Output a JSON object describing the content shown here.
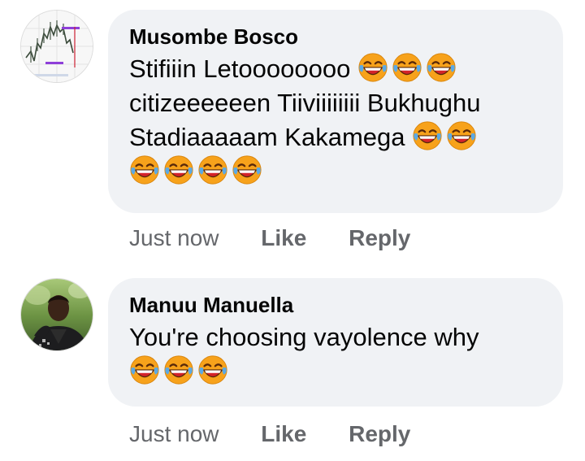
{
  "comments": [
    {
      "author": "Musombe Bosco",
      "lines": [
        {
          "text": "Stifiiin Letoooooooo",
          "emoji_count": 3
        },
        {
          "text": "citizeeeeeen Tiiviiiiiiii Bukhughu",
          "emoji_count": 0
        },
        {
          "text": "Stadiaaaaam Kakamega",
          "emoji_count": 2
        },
        {
          "text": "",
          "emoji_count": 4
        }
      ],
      "avatar_icon": "stock-chart-avatar",
      "actions": {
        "time": "Just now",
        "like": "Like",
        "reply": "Reply"
      }
    },
    {
      "author": "Manuu Manuella",
      "lines": [
        {
          "text": "You're choosing vayolence why",
          "emoji_count": 0
        },
        {
          "text": "",
          "emoji_count": 3
        }
      ],
      "avatar_icon": "person-photo-avatar",
      "actions": {
        "time": "Just now",
        "like": "Like",
        "reply": "Reply"
      }
    }
  ],
  "emoji_icon": "face-with-tears-of-joy-icon",
  "colors": {
    "bubble": "#f0f2f5",
    "meta_text": "#65676b",
    "text": "#050505",
    "emoji_face": "#f7a21b",
    "emoji_mouth": "#d4232a",
    "emoji_tear": "#5aa9e6"
  }
}
